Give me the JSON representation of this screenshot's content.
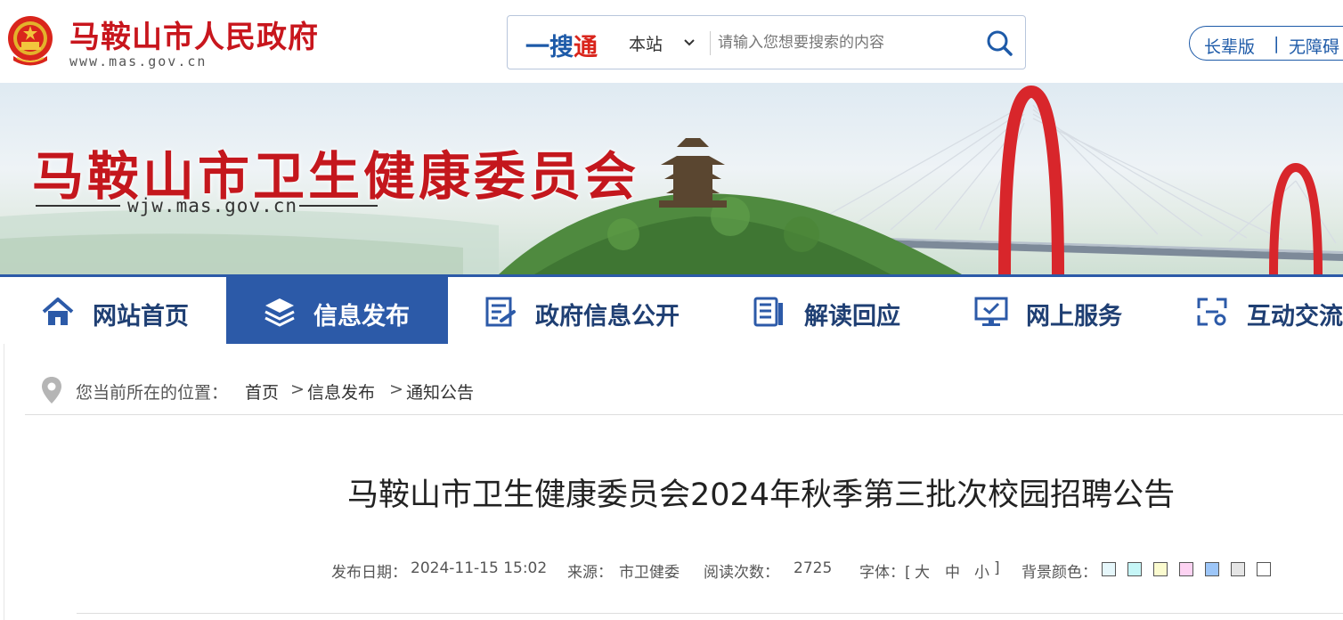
{
  "header": {
    "gov_name": "马鞍山市人民政府",
    "gov_url": "www.mas.gov.cn",
    "search": {
      "brand_a": "一搜",
      "brand_b": "通",
      "scope": "本站",
      "placeholder": "请输入您想要搜索的内容",
      "icon": "search-icon"
    },
    "accessibility": {
      "elder": "长辈版",
      "separator": "|",
      "barrier_free": "无障碍"
    }
  },
  "banner": {
    "title": "马鞍山市卫生健康委员会",
    "url": "wjw.mas.gov.cn"
  },
  "nav": {
    "items": [
      {
        "label": "网站首页",
        "icon": "home-icon"
      },
      {
        "label": "信息发布",
        "icon": "layers-icon"
      },
      {
        "label": "政府信息公开",
        "icon": "document-icon"
      },
      {
        "label": "解读回应",
        "icon": "report-icon"
      },
      {
        "label": "网上服务",
        "icon": "monitor-icon"
      },
      {
        "label": "互动交流",
        "icon": "interaction-icon"
      }
    ],
    "active_index": 1
  },
  "breadcrumb": {
    "prefix": "您当前所在的位置：",
    "items": [
      "首页",
      "信息发布",
      "通知公告"
    ],
    "separator": ">"
  },
  "article": {
    "title": "马鞍山市卫生健康委员会2024年秋季第三批次校园招聘公告",
    "publish_label": "发布日期：",
    "publish_date": "2024-11-15 15:02",
    "source_label": "来源：",
    "source": "市卫健委",
    "reads_label": "阅读次数：",
    "reads": "2725",
    "font_label": "字体：[",
    "font_large": "大",
    "font_medium": "中",
    "font_small": "小",
    "font_close": "]",
    "bg_label": "背景颜色：",
    "bg_colors": [
      "#e6f7fb",
      "#c6f6f7",
      "#fbfbcf",
      "#fdd3f2",
      "#9dc6f8",
      "#e5e5e5",
      "#ffffff"
    ]
  },
  "colors": {
    "brand_red": "#c8161d",
    "brand_blue": "#2c5aa8",
    "nav_text": "#1f3f73"
  }
}
